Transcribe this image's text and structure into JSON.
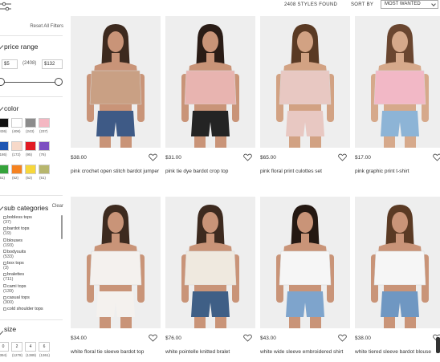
{
  "sidebar": {
    "reset_label": "Reset All Filters",
    "price_range": {
      "title": "price range",
      "min_value": "$5",
      "count": "(2408)",
      "max_value": "$132",
      "slider": {
        "min": 5,
        "max": 132
      }
    },
    "color": {
      "title": "color",
      "swatches": [
        {
          "name": "black",
          "hex": "#111111",
          "count": "(436)"
        },
        {
          "name": "white",
          "hex": "#ffffff",
          "count": "(406)"
        },
        {
          "name": "grey",
          "hex": "#8c8c8c",
          "count": "(243)"
        },
        {
          "name": "pink",
          "hex": "#f4b7c2",
          "count": "(237)"
        },
        {
          "name": "blue",
          "hex": "#1e56b3",
          "count": "(186)"
        },
        {
          "name": "nude",
          "hex": "#f7d9c9",
          "count": "(172)"
        },
        {
          "name": "red",
          "hex": "#e21b23",
          "count": "(95)"
        },
        {
          "name": "purple",
          "hex": "#7d4fc1",
          "count": "(76)"
        },
        {
          "name": "green",
          "hex": "#35a33b",
          "count": "(61)"
        },
        {
          "name": "orange",
          "hex": "#f58220",
          "count": "(52)"
        },
        {
          "name": "yellow",
          "hex": "#f7d73b",
          "count": "(52)"
        },
        {
          "name": "khaki",
          "hex": "#b7b66d",
          "count": "(51)"
        }
      ]
    },
    "sub_categories": {
      "title": "sub categories",
      "clear_label": "Clear",
      "items": [
        {
          "label": "bobless tops",
          "count": "(37)"
        },
        {
          "label": "bardot tops",
          "count": "(19)"
        },
        {
          "label": "blouses",
          "count": "(193)"
        },
        {
          "label": "bodysuits",
          "count": "(533)"
        },
        {
          "label": "box tops",
          "count": "(3)"
        },
        {
          "label": "bralettes",
          "count": "(711)"
        },
        {
          "label": "cami tops",
          "count": "(139)"
        },
        {
          "label": "casual tops",
          "count": "(300)"
        },
        {
          "label": "cold shoulder tops",
          "count": ""
        }
      ]
    },
    "size": {
      "title": "size",
      "options": [
        {
          "label": "0",
          "count": "(394)"
        },
        {
          "label": "2",
          "count": "(1278)"
        },
        {
          "label": "4",
          "count": "(1389)"
        },
        {
          "label": "6",
          "count": "(1361)"
        }
      ]
    }
  },
  "header": {
    "styles_found": "2408 STYLES FOUND",
    "sort_label": "SORT BY",
    "sort_value": "MOST WANTED"
  },
  "products": [
    {
      "price": "$38.00",
      "name": "pink crochet open stitch bardot jumper",
      "top": "#c9a084",
      "bottom": "#3e5a86",
      "skin": "#c99478",
      "hair": "#3d2a1f",
      "bg": "#eeeeee"
    },
    {
      "price": "$31.00",
      "name": "pink tie dye bardot crop top",
      "top": "#e8b4b0",
      "bottom": "#242424",
      "skin": "#c99478",
      "hair": "#2a1c16",
      "bg": "#eeeeee"
    },
    {
      "price": "$65.00",
      "name": "pink floral print culottes set",
      "top": "#e8c8c2",
      "bottom": "#e8c8c2",
      "skin": "#d2a283",
      "hair": "#5a3a24",
      "bg": "#eeeeee"
    },
    {
      "price": "$17.00",
      "name": "pink graphic print t-shirt",
      "top": "#f2b8c6",
      "bottom": "#8db4d6",
      "skin": "#d6a98b",
      "hair": "#6a4630",
      "bg": "#eeeeee"
    },
    {
      "price": "$34.00",
      "name": "white floral tie sleeve bardot top",
      "top": "#f4f1ee",
      "bottom": "#f4f1ee",
      "skin": "#c99478",
      "hair": "#3d2a1f",
      "bg": "#eeeeee"
    },
    {
      "price": "$76.00",
      "name": "white pointelle knitted bralet",
      "top": "#efe9df",
      "bottom": "#3f5f86",
      "skin": "#c99478",
      "hair": "#3d2a1f",
      "bg": "#eeeeee"
    },
    {
      "price": "$43.00",
      "name": "white wide sleeve embroidered shirt",
      "top": "#f6f6f6",
      "bottom": "#7ea4cc",
      "skin": "#c99478",
      "hair": "#241812",
      "bg": "#eeeeee"
    },
    {
      "price": "$38.00",
      "name": "white tiered sleeve bardot blouse",
      "top": "#f6f6f6",
      "bottom": "#6f97c2",
      "skin": "#c99478",
      "hair": "#5a3a24",
      "bg": "#eeeeee"
    }
  ]
}
